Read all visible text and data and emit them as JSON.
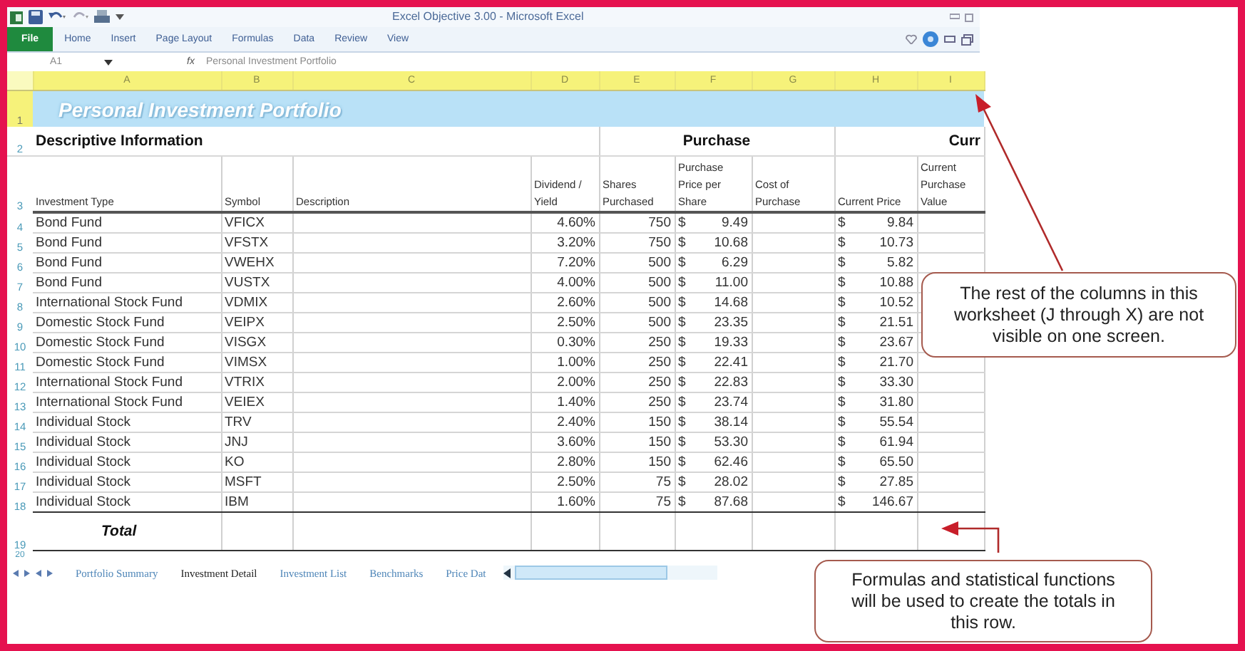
{
  "window": {
    "title": "Excel Objective 3.00  -  Microsoft Excel"
  },
  "ribbon_tabs": [
    {
      "label": "File",
      "kind": "file",
      "selected": false
    },
    {
      "label": "Home",
      "kind": "tab",
      "selected": false
    },
    {
      "label": "Insert",
      "kind": "tab",
      "selected": false
    },
    {
      "label": "Page Layout",
      "kind": "tab",
      "selected": false
    },
    {
      "label": "Formulas",
      "kind": "tab",
      "selected": false
    },
    {
      "label": "Data",
      "kind": "tab",
      "selected": false
    },
    {
      "label": "Review",
      "kind": "tab",
      "selected": false
    },
    {
      "label": "View",
      "kind": "tab",
      "selected": false
    }
  ],
  "formula_bar": {
    "name_box": "A1",
    "fx": "fx",
    "formula": "Personal Investment Portfolio"
  },
  "columns": [
    "A",
    "B",
    "C",
    "D",
    "E",
    "F",
    "G",
    "H",
    "I"
  ],
  "title_row": {
    "row": "1",
    "text": "Personal Investment Portfolio"
  },
  "group_row": {
    "row": "2",
    "left": "Descriptive Information",
    "middle": "Purchase",
    "right": "Curr"
  },
  "header_row": {
    "row": "3",
    "cells": [
      "Investment Type",
      "Symbol",
      "Description",
      "Dividend / Yield",
      "Shares Purchased",
      "Purchase Price per Share",
      "Cost of Purchase",
      "Current Price",
      "Current Purchase Value"
    ]
  },
  "rows": [
    {
      "row": "4",
      "type": "Bond Fund",
      "symbol": "VFICX",
      "yield": "4.60%",
      "shares": "750",
      "purchase": [
        "$",
        "9.49"
      ],
      "current": [
        "$",
        "9.84"
      ]
    },
    {
      "row": "5",
      "type": "Bond Fund",
      "symbol": "VFSTX",
      "yield": "3.20%",
      "shares": "750",
      "purchase": [
        "$",
        "10.68"
      ],
      "current": [
        "$",
        "10.73"
      ]
    },
    {
      "row": "6",
      "type": "Bond Fund",
      "symbol": "VWEHX",
      "yield": "7.20%",
      "shares": "500",
      "purchase": [
        "$",
        "6.29"
      ],
      "current": [
        "$",
        "5.82"
      ]
    },
    {
      "row": "7",
      "type": "Bond Fund",
      "symbol": "VUSTX",
      "yield": "4.00%",
      "shares": "500",
      "purchase": [
        "$",
        "11.00"
      ],
      "current": [
        "$",
        "10.88"
      ]
    },
    {
      "row": "8",
      "type": "International Stock Fund",
      "symbol": "VDMIX",
      "yield": "2.60%",
      "shares": "500",
      "purchase": [
        "$",
        "14.68"
      ],
      "current": [
        "$",
        "10.52"
      ]
    },
    {
      "row": "9",
      "type": "Domestic Stock Fund",
      "symbol": "VEIPX",
      "yield": "2.50%",
      "shares": "500",
      "purchase": [
        "$",
        "23.35"
      ],
      "current": [
        "$",
        "21.51"
      ]
    },
    {
      "row": "10",
      "type": "Domestic Stock Fund",
      "symbol": "VISGX",
      "yield": "0.30%",
      "shares": "250",
      "purchase": [
        "$",
        "19.33"
      ],
      "current": [
        "$",
        "23.67"
      ]
    },
    {
      "row": "11",
      "type": "Domestic Stock Fund",
      "symbol": "VIMSX",
      "yield": "1.00%",
      "shares": "250",
      "purchase": [
        "$",
        "22.41"
      ],
      "current": [
        "$",
        "21.70"
      ]
    },
    {
      "row": "12",
      "type": "International Stock Fund",
      "symbol": "VTRIX",
      "yield": "2.00%",
      "shares": "250",
      "purchase": [
        "$",
        "22.83"
      ],
      "current": [
        "$",
        "33.30"
      ]
    },
    {
      "row": "13",
      "type": "International Stock Fund",
      "symbol": "VEIEX",
      "yield": "1.40%",
      "shares": "250",
      "purchase": [
        "$",
        "23.74"
      ],
      "current": [
        "$",
        "31.80"
      ]
    },
    {
      "row": "14",
      "type": "Individual Stock",
      "symbol": "TRV",
      "yield": "2.40%",
      "shares": "150",
      "purchase": [
        "$",
        "38.14"
      ],
      "current": [
        "$",
        "55.54"
      ]
    },
    {
      "row": "15",
      "type": "Individual Stock",
      "symbol": "JNJ",
      "yield": "3.60%",
      "shares": "150",
      "purchase": [
        "$",
        "53.30"
      ],
      "current": [
        "$",
        "61.94"
      ]
    },
    {
      "row": "16",
      "type": "Individual Stock",
      "symbol": "KO",
      "yield": "2.80%",
      "shares": "150",
      "purchase": [
        "$",
        "62.46"
      ],
      "current": [
        "$",
        "65.50"
      ]
    },
    {
      "row": "17",
      "type": "Individual Stock",
      "symbol": "MSFT",
      "yield": "2.50%",
      "shares": "75",
      "purchase": [
        "$",
        "28.02"
      ],
      "current": [
        "$",
        "27.85"
      ]
    },
    {
      "row": "18",
      "type": "Individual Stock",
      "symbol": "IBM",
      "yield": "1.60%",
      "shares": "75",
      "purchase": [
        "$",
        "87.68"
      ],
      "current": [
        "$",
        "146.67"
      ]
    }
  ],
  "total_row": {
    "row": "19",
    "label": "Total"
  },
  "last_row": {
    "row": "20"
  },
  "sheet_tabs": [
    {
      "label": "Portfolio Summary",
      "selected": false
    },
    {
      "label": "Investment Detail",
      "selected": true
    },
    {
      "label": "Investment List",
      "selected": false
    },
    {
      "label": "Benchmarks",
      "selected": false
    },
    {
      "label": "Price Dat",
      "selected": false
    }
  ],
  "callouts": [
    "The rest of the columns in this worksheet (J through X) are not visible on one screen.",
    "Formulas and statistical functions will be used to create the totals in this row."
  ]
}
